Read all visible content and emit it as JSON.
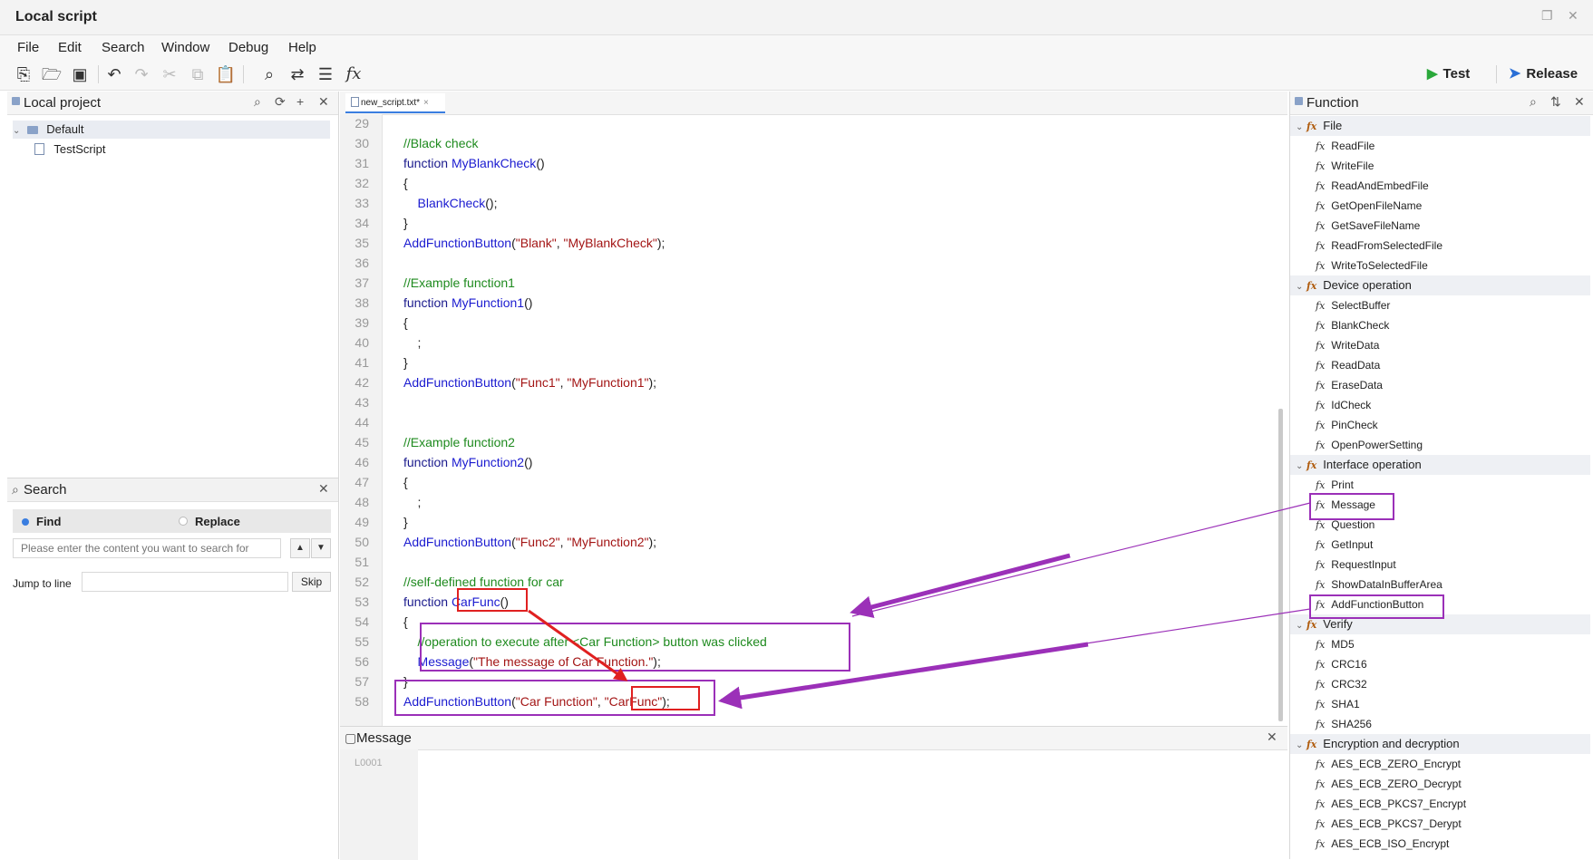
{
  "window": {
    "title": "Local script"
  },
  "menu": [
    "File",
    "Edit",
    "Search",
    "Window",
    "Debug",
    "Help"
  ],
  "toolbar": {
    "icons": [
      "new-file-icon",
      "open-folder-icon",
      "save-icon",
      "undo-icon",
      "redo-icon",
      "cut-icon",
      "copy-icon",
      "paste-icon",
      "search-icon",
      "replace-icon",
      "format-icon",
      "function-icon"
    ],
    "test_label": "Test",
    "release_label": "Release"
  },
  "left_panel": {
    "title": "Local project",
    "tree": [
      {
        "label": "Default",
        "type": "folder"
      },
      {
        "label": "TestScript",
        "type": "file"
      }
    ]
  },
  "search": {
    "title": "Search",
    "find_label": "Find",
    "replace_label": "Replace",
    "placeholder": "Please enter the content you want to search for",
    "jump_label": "Jump to line",
    "skip_label": "Skip"
  },
  "editor": {
    "tab": "new_script.txt*",
    "tab_close": "×",
    "line_numbers": [
      "29",
      "30",
      "31",
      "32",
      "33",
      "34",
      "35",
      "36",
      "37",
      "38",
      "39",
      "40",
      "41",
      "42",
      "43",
      "44",
      "45",
      "46",
      "47",
      "48",
      "49",
      "50",
      "51",
      "52",
      "53",
      "54",
      "55",
      "56",
      "57",
      "58"
    ]
  },
  "message": {
    "title": "Message",
    "line": "L0001"
  },
  "function_panel": {
    "title": "Function",
    "categories": [
      {
        "name": "File",
        "items": [
          "ReadFile",
          "WriteFile",
          "ReadAndEmbedFile",
          "GetOpenFileName",
          "GetSaveFileName",
          "ReadFromSelectedFile",
          "WriteToSelectedFile"
        ]
      },
      {
        "name": "Device operation",
        "items": [
          "SelectBuffer",
          "BlankCheck",
          "WriteData",
          "ReadData",
          "EraseData",
          "IdCheck",
          "PinCheck",
          "OpenPowerSetting"
        ]
      },
      {
        "name": "Interface operation",
        "items": [
          "Print",
          "Message",
          "Question",
          "GetInput",
          "RequestInput",
          "ShowDataInBufferArea",
          "AddFunctionButton"
        ]
      },
      {
        "name": "Verify",
        "items": [
          "MD5",
          "CRC16",
          "CRC32",
          "SHA1",
          "SHA256"
        ]
      },
      {
        "name": "Encryption and decryption",
        "items": [
          "AES_ECB_ZERO_Encrypt",
          "AES_ECB_ZERO_Decrypt",
          "AES_ECB_PKCS7_Encrypt",
          "AES_ECB_PKCS7_Derypt",
          "AES_ECB_ISO_Encrypt"
        ]
      }
    ]
  },
  "colors": {
    "keyword": "#1a1a8c",
    "function": "#1b1bd0",
    "comment": "#1e8a1e",
    "string": "#a31515",
    "annotation_purple": "#9b30b8",
    "annotation_red": "#e02020",
    "run_green": "#2aa83a",
    "release_blue": "#2a6fd6"
  }
}
